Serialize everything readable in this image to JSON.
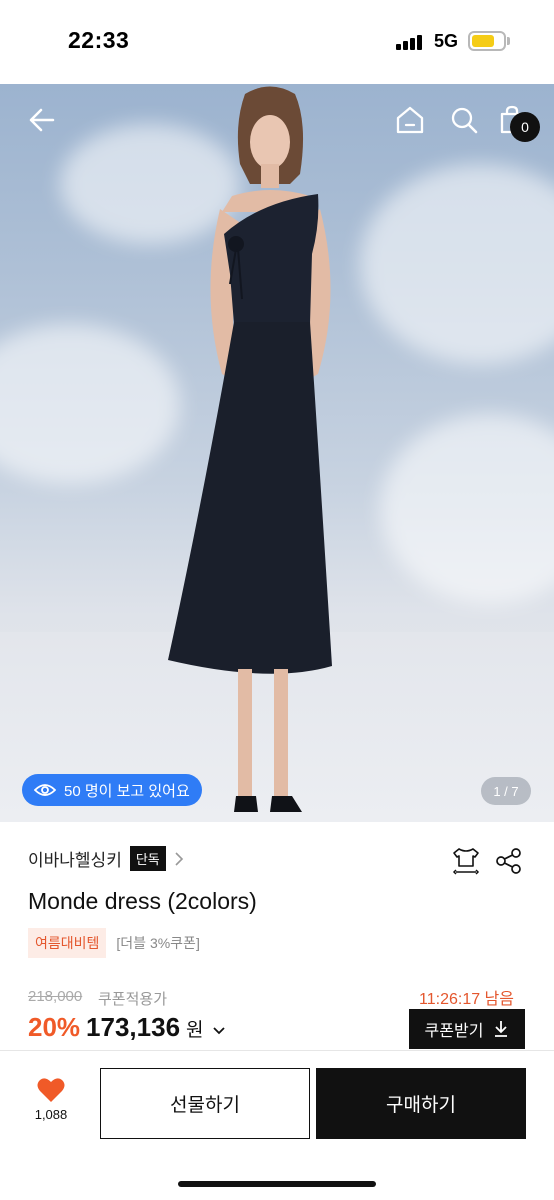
{
  "status_bar": {
    "time": "22:33",
    "network": "5G",
    "icons": [
      "signal-icon",
      "battery-icon"
    ],
    "battery_color": "#f5cc16"
  },
  "header": {
    "icons": [
      "back-arrow-icon",
      "home-icon",
      "search-icon",
      "shopping-bag-icon"
    ],
    "cart_count": "0"
  },
  "gallery": {
    "viewers_text": "50 명이 보고 있어요",
    "counter": "1 / 7",
    "viewers_pill_color": "#2f7cf6"
  },
  "product": {
    "brand": "이바나헬싱키",
    "exclusive_label": "단독",
    "name": "Monde dress (2colors)",
    "event_tag": "여름대비템",
    "coupon_tag": "[더블 3%쿠폰]",
    "original_price": "218,000",
    "coupon_applied_label": "쿠폰적용가",
    "countdown": "11:26:17 남음",
    "discount_rate": "20%",
    "sale_price": "173,136",
    "currency": "원",
    "coupon_button": "쿠폰받기",
    "accent_color": "#f05a28"
  },
  "actions": {
    "like_count": "1,088",
    "gift_label": "선물하기",
    "buy_label": "구매하기"
  }
}
